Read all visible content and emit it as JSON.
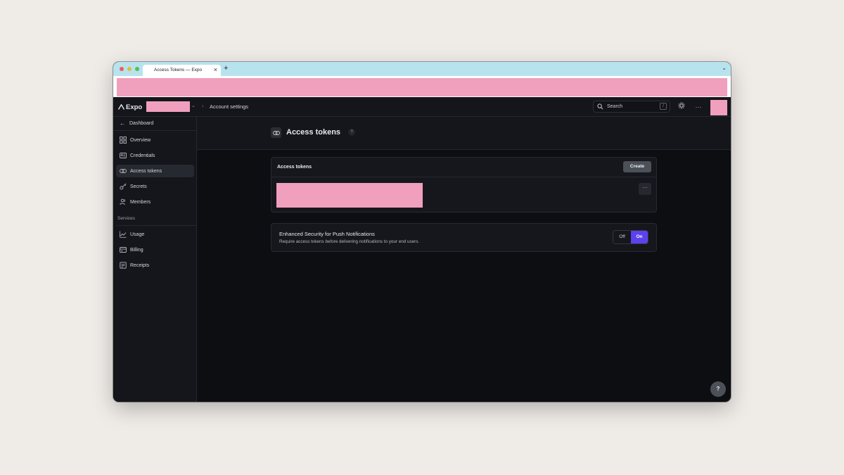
{
  "browser": {
    "tab_title": "Access Tokens — Expo",
    "tab_close": "×",
    "new_tab": "+",
    "tabbar_chevron": "⌄"
  },
  "header": {
    "logo_text": "Expo",
    "breadcrumb_separator": "›",
    "breadcrumb": "Account settings",
    "search_placeholder": "Search",
    "search_shortcut": "/",
    "more_label": "···"
  },
  "sidebar": {
    "back_label": "Dashboard",
    "items": [
      {
        "label": "Overview",
        "icon": "grid-icon",
        "active": false
      },
      {
        "label": "Credentials",
        "icon": "id-card-icon",
        "active": false
      },
      {
        "label": "Access tokens",
        "icon": "token-icon",
        "active": true
      },
      {
        "label": "Secrets",
        "icon": "key-icon",
        "active": false
      },
      {
        "label": "Members",
        "icon": "members-icon",
        "active": false
      }
    ],
    "services_heading": "Services",
    "services": [
      {
        "label": "Usage",
        "icon": "chart-icon"
      },
      {
        "label": "Billing",
        "icon": "billing-icon"
      },
      {
        "label": "Receipts",
        "icon": "receipt-icon"
      }
    ]
  },
  "page": {
    "title": "Access tokens",
    "help": "?"
  },
  "tokens_card": {
    "title": "Access tokens",
    "create_label": "Create",
    "more_label": "···"
  },
  "push_card": {
    "title": "Enhanced Security for Push Notifications",
    "description": "Require access tokens before delivering notifications to your end users.",
    "off_label": "Off",
    "on_label": "On",
    "selected": "On"
  },
  "help_fab": "?",
  "colors": {
    "accent": "#5b42ee",
    "background": "#0c0e11",
    "panel": "#14161b",
    "redaction": "#f09fbd"
  }
}
